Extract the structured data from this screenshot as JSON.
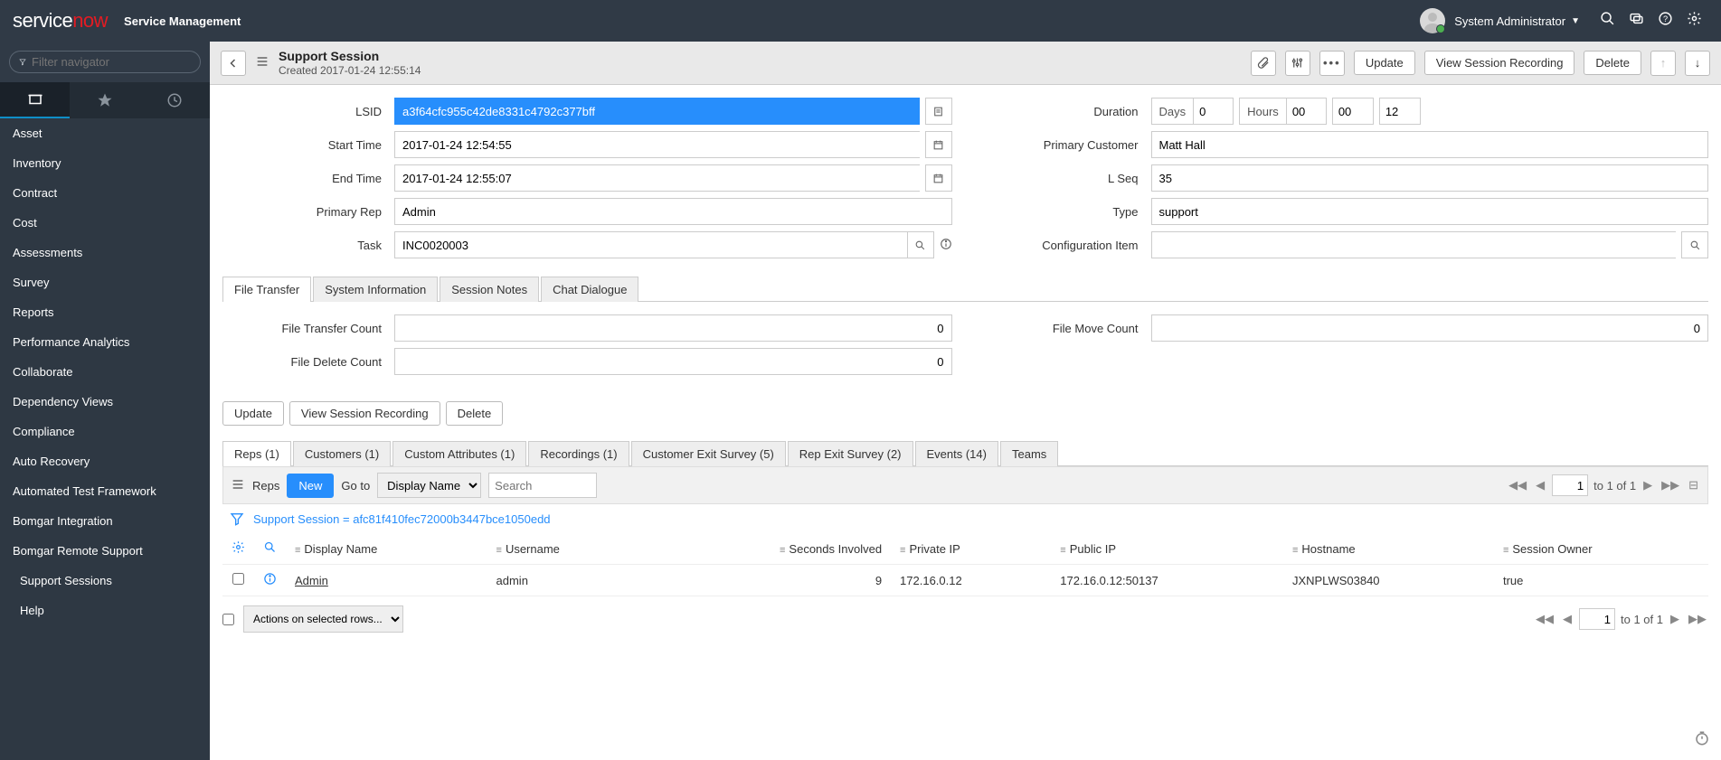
{
  "brand": {
    "white": "service",
    "red": "now",
    "app": "Service Management"
  },
  "user": {
    "name": "System Administrator"
  },
  "nav": {
    "filter_placeholder": "Filter navigator",
    "items": [
      "Asset",
      "Inventory",
      "Contract",
      "Cost",
      "Assessments",
      "Survey",
      "Reports",
      "Performance Analytics",
      "Collaborate",
      "Dependency Views",
      "Compliance",
      "Auto Recovery",
      "Automated Test Framework",
      "Bomgar Integration",
      "Bomgar Remote Support"
    ],
    "subitems": [
      "Support Sessions",
      "Help"
    ]
  },
  "header": {
    "title": "Support Session",
    "subtitle": "Created 2017-01-24 12:55:14",
    "buttons": {
      "update": "Update",
      "view_rec": "View Session Recording",
      "delete": "Delete"
    }
  },
  "form": {
    "left": {
      "lsid_label": "LSID",
      "lsid": "a3f64cfc955c42de8331c4792c377bff",
      "start_label": "Start Time",
      "start": "2017-01-24 12:54:55",
      "end_label": "End Time",
      "end": "2017-01-24 12:55:07",
      "rep_label": "Primary Rep",
      "rep": "Admin",
      "task_label": "Task",
      "task": "INC0020003"
    },
    "right": {
      "duration_label": "Duration",
      "duration": {
        "days_lbl": "Days",
        "days": "0",
        "hours_lbl": "Hours",
        "hours": "00",
        "mins": "00",
        "secs": "12"
      },
      "cust_label": "Primary Customer",
      "cust": "Matt Hall",
      "lseq_label": "L Seq",
      "lseq": "35",
      "type_label": "Type",
      "type": "support",
      "ci_label": "Configuration Item",
      "ci": ""
    }
  },
  "section_tabs": [
    "File Transfer",
    "System Information",
    "Session Notes",
    "Chat Dialogue"
  ],
  "file_transfer": {
    "ftc_label": "File Transfer Count",
    "ftc": "0",
    "fdc_label": "File Delete Count",
    "fdc": "0",
    "fmc_label": "File Move Count",
    "fmc": "0"
  },
  "rel_tabs": [
    "Reps (1)",
    "Customers (1)",
    "Custom Attributes (1)",
    "Recordings (1)",
    "Customer Exit Survey (5)",
    "Rep Exit Survey (2)",
    "Events (14)",
    "Teams"
  ],
  "list": {
    "title": "Reps",
    "new_btn": "New",
    "goto_label": "Go to",
    "goto_field": "Display Name",
    "search_placeholder": "Search",
    "crumb": "Support Session = afc81f410fec72000b3447bce1050edd",
    "headers": [
      "Display Name",
      "Username",
      "Seconds Involved",
      "Private IP",
      "Public IP",
      "Hostname",
      "Session Owner"
    ],
    "row": {
      "display_name": "Admin",
      "username": "admin",
      "seconds": "9",
      "private_ip": "172.16.0.12",
      "public_ip": "172.16.0.12:50137",
      "hostname": "JXNPLWS03840",
      "owner": "true"
    },
    "pager": {
      "page": "1",
      "range": "to 1 of 1"
    },
    "actions_placeholder": "Actions on selected rows..."
  }
}
